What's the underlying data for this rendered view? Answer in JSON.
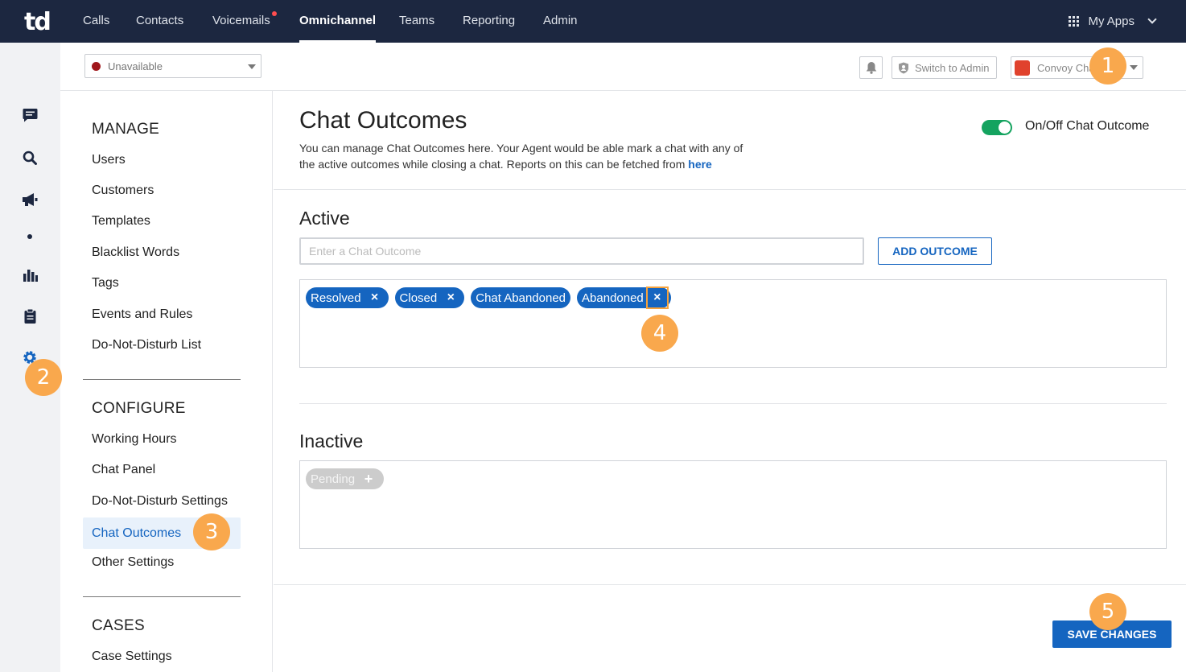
{
  "app": {
    "logo_text": "td"
  },
  "topnav": {
    "items": [
      {
        "label": "Calls",
        "active": false
      },
      {
        "label": "Contacts",
        "active": false
      },
      {
        "label": "Voicemails",
        "active": false,
        "notification_dot": true
      },
      {
        "label": "Omnichannel",
        "active": true
      },
      {
        "label": "Teams",
        "active": false
      },
      {
        "label": "Reporting",
        "active": false
      },
      {
        "label": "Admin",
        "active": false
      }
    ],
    "my_apps_label": "My Apps"
  },
  "rail": {
    "icons": [
      "chat-icon",
      "search-icon",
      "megaphone-icon",
      "dot-icon",
      "bar-chart-icon",
      "clipboard-icon",
      "gear-icon"
    ]
  },
  "subheader": {
    "status_value": "Unavailable",
    "status_color": "#a0161b",
    "switch_admin_label": "Switch to Admin",
    "account_label": "Convoy Cha"
  },
  "settings_nav": {
    "manage_heading": "MANAGE",
    "manage_items": [
      "Users",
      "Customers",
      "Templates",
      "Blacklist Words",
      "Tags",
      "Events and Rules",
      "Do-Not-Disturb List"
    ],
    "configure_heading": "CONFIGURE",
    "configure_items": [
      "Working Hours",
      "Chat Panel",
      "Do-Not-Disturb Settings",
      "Chat Outcomes",
      "Other Settings"
    ],
    "active_item": "Chat Outcomes",
    "cases_heading": "CASES",
    "cases_items": [
      "Case Settings"
    ]
  },
  "main": {
    "title": "Chat Outcomes",
    "description": "You can manage Chat Outcomes here. Your Agent would be able mark a chat with any of the active outcomes while closing a chat. Reports on this can be fetched from",
    "description_link": "here",
    "toggle_label": "On/Off Chat Outcome",
    "toggle_on": true,
    "active_heading": "Active",
    "input_placeholder": "Enter a Chat Outcome",
    "add_button": "ADD OUTCOME",
    "active_outcomes": [
      "Resolved",
      "Closed",
      "Chat Abandoned",
      "Abandoned"
    ],
    "inactive_heading": "Inactive",
    "inactive_outcomes": [
      "Pending"
    ],
    "save_button": "SAVE CHANGES"
  },
  "steps": [
    "1",
    "2",
    "3",
    "4",
    "5"
  ],
  "colors": {
    "nav_bg": "#1c2740",
    "accent": "#1565c0",
    "toggle": "#14a35f",
    "step": "#f9a84d"
  }
}
